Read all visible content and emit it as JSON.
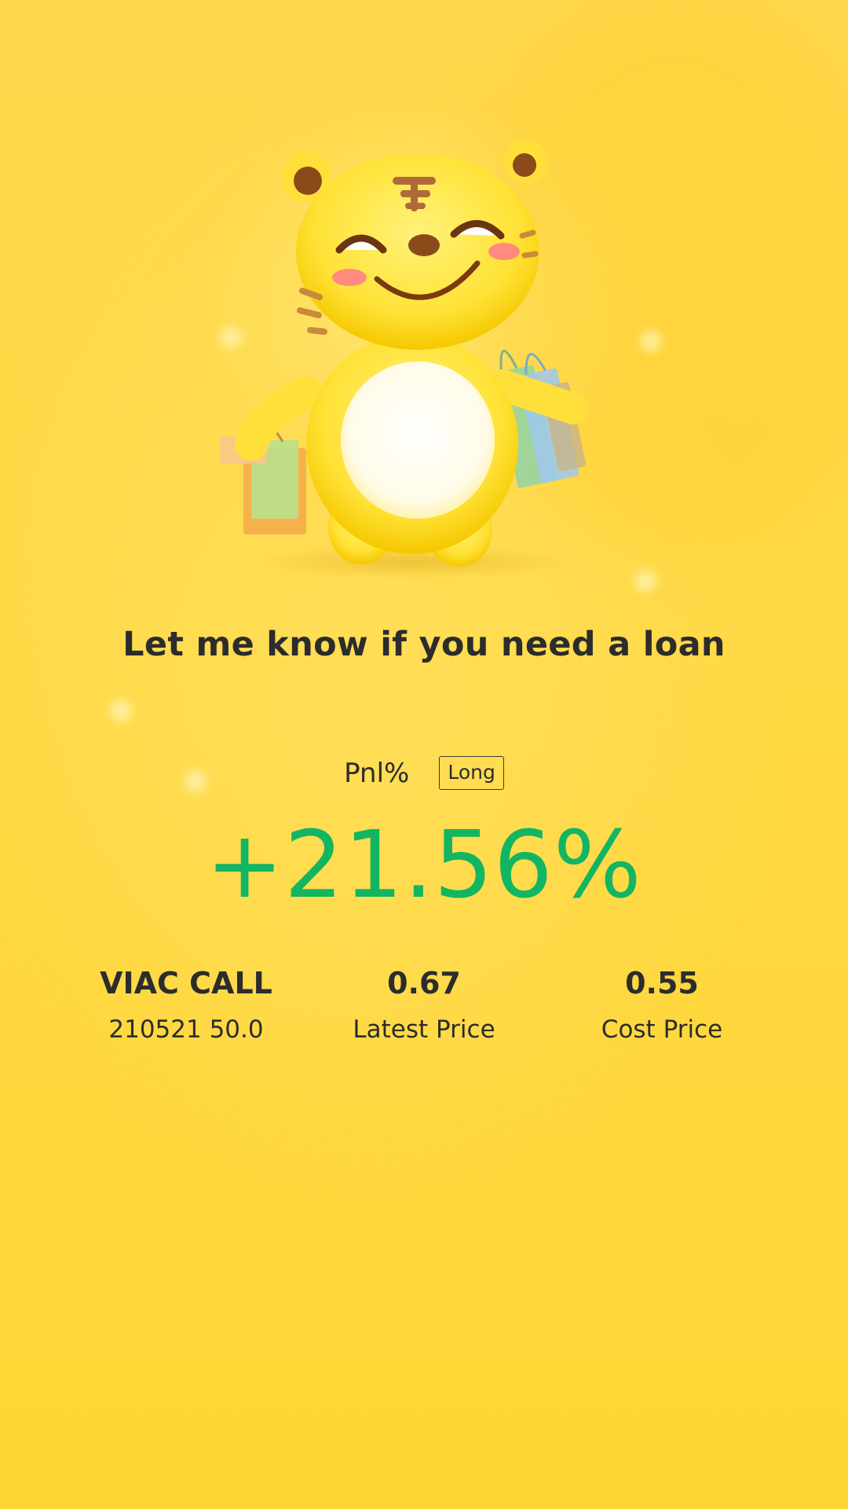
{
  "headline": "Let me know if you need a loan",
  "pnl": {
    "label": "Pnl%",
    "side_badge": "Long",
    "value": "+21.56%",
    "value_color": "#12b562"
  },
  "contract": {
    "name": "VIAC CALL",
    "detail": "210521 50.0"
  },
  "latest_price": {
    "value": "0.67",
    "label": "Latest Price"
  },
  "cost_price": {
    "value": "0.55",
    "label": "Cost Price"
  },
  "mascot": {
    "icon": "tiger-mascot-shopping-icon"
  },
  "colors": {
    "background": "#ffd744",
    "text": "#2c2c2c",
    "profit": "#12b562"
  }
}
